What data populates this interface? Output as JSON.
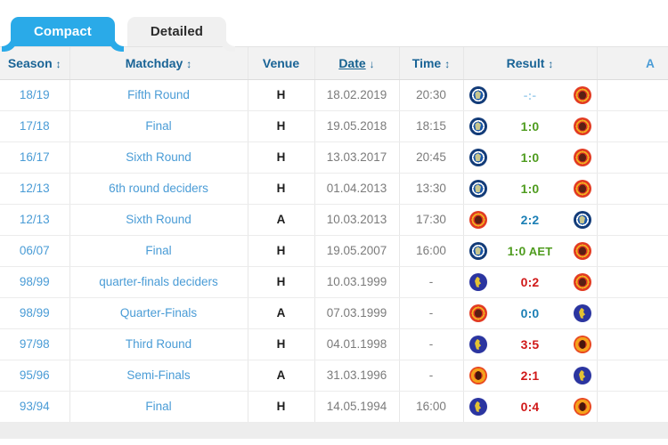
{
  "tabs": [
    {
      "label": "Compact",
      "active": true
    },
    {
      "label": "Detailed",
      "active": false
    }
  ],
  "table": {
    "columns": [
      {
        "key": "season",
        "label": "Season",
        "sort_icon": "↕",
        "style": "link",
        "sorted": false
      },
      {
        "key": "matchday",
        "label": "Matchday",
        "sort_icon": "↕",
        "style": "link",
        "sorted": false
      },
      {
        "key": "venue",
        "label": "Venue",
        "sort_icon": "",
        "style": "plain",
        "sorted": false
      },
      {
        "key": "date",
        "label": "Date",
        "sort_icon": "↓",
        "style": "link",
        "sorted": true
      },
      {
        "key": "time",
        "label": "Time",
        "sort_icon": "↕",
        "style": "link",
        "sorted": false
      },
      {
        "key": "result",
        "label": "Result",
        "sort_icon": "↕",
        "style": "link",
        "sorted": false
      },
      {
        "key": "extra",
        "label": "A",
        "sort_icon": "",
        "style": "link",
        "sorted": false
      }
    ],
    "rows": [
      {
        "season": "18/19",
        "matchday": "Fifth Round",
        "venue": "H",
        "date": "18.02.2019",
        "time": "20:30",
        "home_crest": "chelsea",
        "away_crest": "manutd",
        "score": "-:-",
        "suffix": "",
        "outcome": "none"
      },
      {
        "season": "17/18",
        "matchday": "Final",
        "venue": "H",
        "date": "19.05.2018",
        "time": "18:15",
        "home_crest": "chelsea",
        "away_crest": "manutd",
        "score": "1:0",
        "suffix": "",
        "outcome": "win"
      },
      {
        "season": "16/17",
        "matchday": "Sixth Round",
        "venue": "H",
        "date": "13.03.2017",
        "time": "20:45",
        "home_crest": "chelsea",
        "away_crest": "manutd",
        "score": "1:0",
        "suffix": "",
        "outcome": "win"
      },
      {
        "season": "12/13",
        "matchday": "6th round deciders",
        "venue": "H",
        "date": "01.04.2013",
        "time": "13:30",
        "home_crest": "chelsea",
        "away_crest": "manutd",
        "score": "1:0",
        "suffix": "",
        "outcome": "win"
      },
      {
        "season": "12/13",
        "matchday": "Sixth Round",
        "venue": "A",
        "date": "10.03.2013",
        "time": "17:30",
        "home_crest": "manutd",
        "away_crest": "chelsea",
        "score": "2:2",
        "suffix": "",
        "outcome": "draw"
      },
      {
        "season": "06/07",
        "matchday": "Final",
        "venue": "H",
        "date": "19.05.2007",
        "time": "16:00",
        "home_crest": "chelsea",
        "away_crest": "manutd",
        "score": "1:0",
        "suffix": "AET",
        "outcome": "win"
      },
      {
        "season": "98/99",
        "matchday": "quarter-finals deciders",
        "venue": "H",
        "date": "10.03.1999",
        "time": "-",
        "home_crest": "chelsea-old",
        "away_crest": "manutd",
        "score": "0:2",
        "suffix": "",
        "outcome": "loss"
      },
      {
        "season": "98/99",
        "matchday": "Quarter-Finals",
        "venue": "A",
        "date": "07.03.1999",
        "time": "-",
        "home_crest": "manutd",
        "away_crest": "chelsea-old",
        "score": "0:0",
        "suffix": "",
        "outcome": "draw"
      },
      {
        "season": "97/98",
        "matchday": "Third Round",
        "venue": "H",
        "date": "04.01.1998",
        "time": "-",
        "home_crest": "chelsea-old",
        "away_crest": "manutd-old",
        "score": "3:5",
        "suffix": "",
        "outcome": "loss"
      },
      {
        "season": "95/96",
        "matchday": "Semi-Finals",
        "venue": "A",
        "date": "31.03.1996",
        "time": "-",
        "home_crest": "manutd-old",
        "away_crest": "chelsea-old",
        "score": "2:1",
        "suffix": "",
        "outcome": "loss"
      },
      {
        "season": "93/94",
        "matchday": "Final",
        "venue": "H",
        "date": "14.05.1994",
        "time": "16:00",
        "home_crest": "chelsea-old",
        "away_crest": "manutd-old",
        "score": "0:4",
        "suffix": "",
        "outcome": "loss"
      }
    ]
  },
  "colors": {
    "tab_active_bg": "#2aaae8",
    "tab_inactive_bg": "#f0f0f0",
    "header_bg": "#f2f2f2",
    "header_text": "#1a6496",
    "link": "#4a9cd6",
    "win": "#4f9c1f",
    "draw": "#1b7fb5",
    "loss": "#d01919",
    "muted": "#7b7b7b"
  }
}
